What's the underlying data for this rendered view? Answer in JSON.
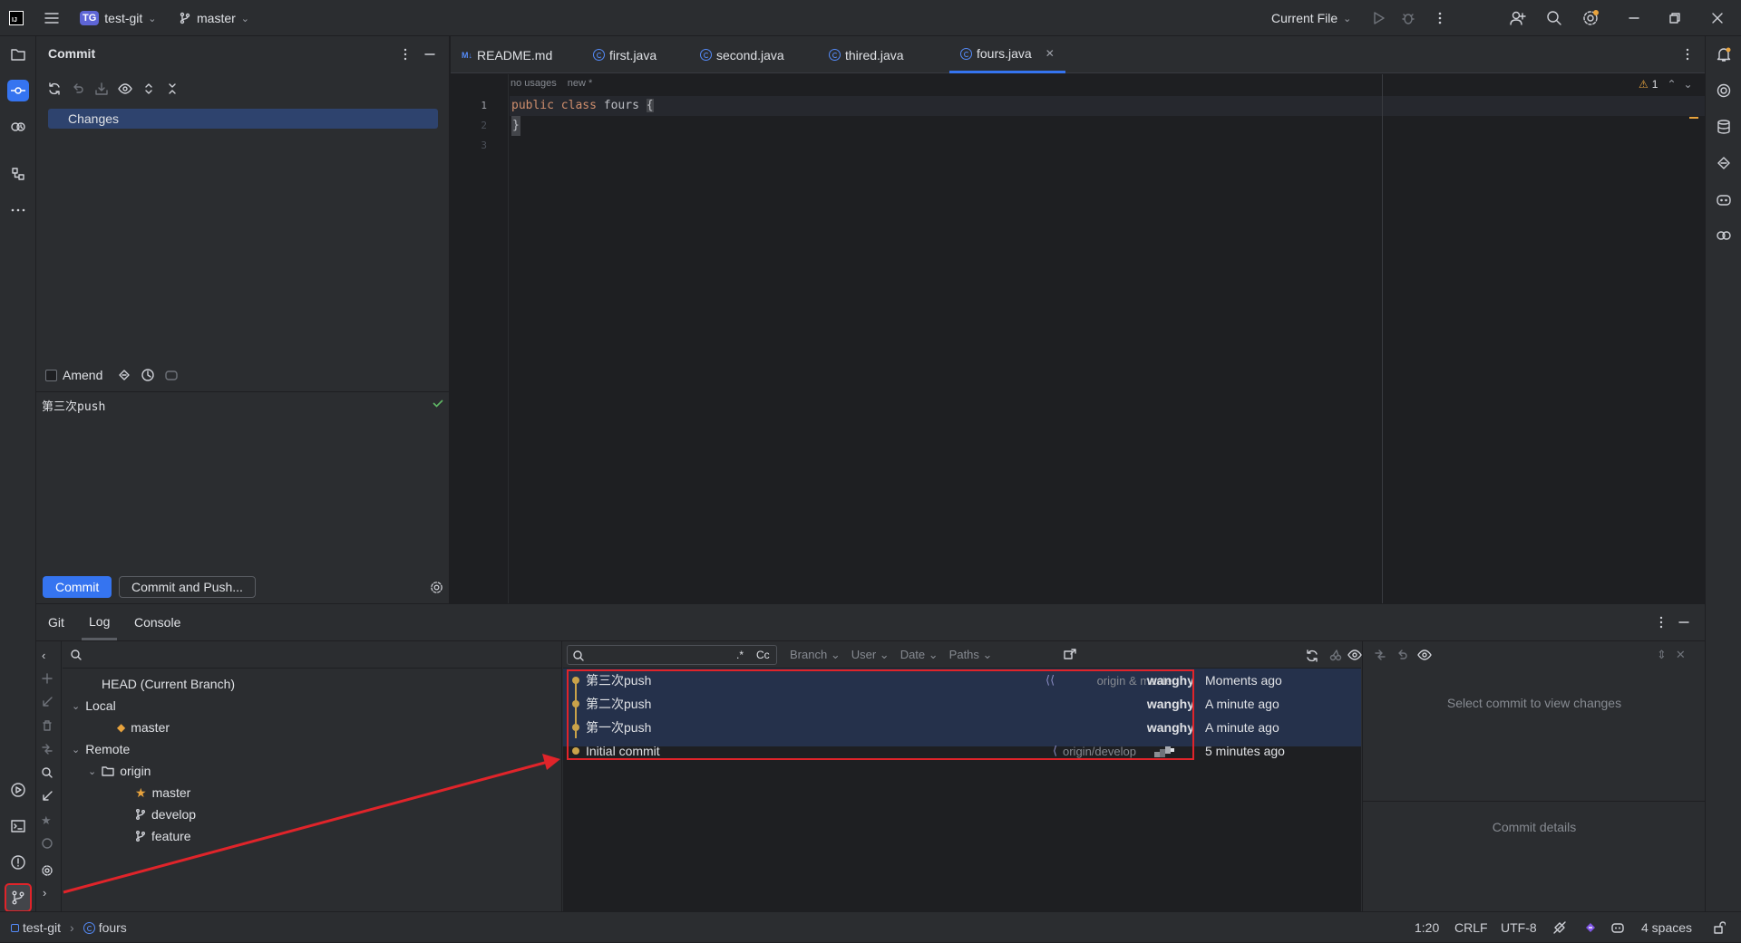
{
  "titlebar": {
    "project_badge": "TG",
    "project_name": "test-git",
    "branch": "master",
    "run_config": "Current File"
  },
  "commit_panel": {
    "title": "Commit",
    "changes_label": "Changes",
    "amend_label": "Amend",
    "message": "第三次push",
    "commit_button": "Commit",
    "commit_push_button": "Commit and Push..."
  },
  "editor": {
    "tabs": [
      {
        "label": "README.md",
        "icon": "M↓"
      },
      {
        "label": "first.java"
      },
      {
        "label": "second.java"
      },
      {
        "label": "thired.java"
      },
      {
        "label": "fours.java"
      }
    ],
    "inlay_usages": "no usages",
    "inlay_new": "new *",
    "warning_count": "1",
    "line_numbers": [
      "1",
      "2",
      "3"
    ],
    "code_keyword1": "public",
    "code_keyword2": "class",
    "code_name": "fours",
    "code_open_brace": "{",
    "code_close_brace": "}"
  },
  "git_window": {
    "tabs": [
      "Git",
      "Log",
      "Console"
    ],
    "branches": {
      "head": "HEAD (Current Branch)",
      "local": "Local",
      "local_master": "master",
      "remote": "Remote",
      "origin": "origin",
      "remote_master": "master",
      "remote_develop": "develop",
      "remote_feature": "feature"
    },
    "filters": {
      "regex": ".*",
      "case": "Cc",
      "branch": "Branch",
      "user": "User",
      "date": "Date",
      "paths": "Paths"
    },
    "commits": [
      {
        "message": "第三次push",
        "refs": "origin & master",
        "author": "wanghy",
        "date": "Moments ago"
      },
      {
        "message": "第二次push",
        "refs": "",
        "author": "wanghy",
        "date": "A minute ago"
      },
      {
        "message": "第一次push",
        "refs": "",
        "author": "wanghy",
        "date": "A minute ago"
      },
      {
        "message": "Initial commit",
        "refs": "origin/develop",
        "author": "",
        "date": "5 minutes ago"
      }
    ],
    "select_commit_hint": "Select commit to view changes",
    "commit_details": "Commit details"
  },
  "statusbar": {
    "project": "test-git",
    "file": "fours",
    "position": "1:20",
    "line_sep": "CRLF",
    "encoding": "UTF-8",
    "indent": "4 spaces"
  },
  "colors": {
    "accent": "#3574f0",
    "highlight_red": "#e0242a",
    "graph_node": "#c9a24a"
  }
}
